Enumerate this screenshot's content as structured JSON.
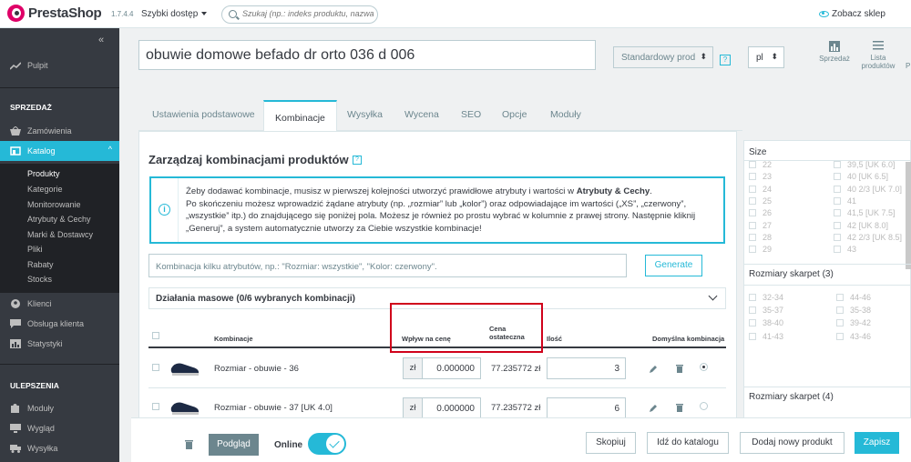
{
  "header": {
    "brand": "PrestaShop",
    "version": "1.7.4.4",
    "quick_access": "Szybki dostęp",
    "search_placeholder": "Szukaj (np.: indeks produktu, nazwa klie",
    "view_shop": "Zobacz sklep"
  },
  "sidebar": {
    "dashboard": "Pulpit",
    "section_sales": "SPRZEDAŻ",
    "orders": "Zamówienia",
    "catalog": "Katalog",
    "catalog_items": [
      "Produkty",
      "Kategorie",
      "Monitorowanie",
      "Atrybuty & Cechy",
      "Marki & Dostawcy",
      "Pliki",
      "Rabaty",
      "Stocks"
    ],
    "customers": "Klienci",
    "service": "Obsługa klienta",
    "stats": "Statystyki",
    "section_improve": "ULEPSZENIA",
    "modules": "Moduły",
    "design": "Wygląd",
    "shipping": "Wysyłka"
  },
  "product": {
    "name": "obuwie domowe befado dr orto 036 d 006",
    "type": "Standardowy prod",
    "lang": "pl"
  },
  "toolbar": {
    "sales": "Sprzedaż",
    "product_list_1": "Lista",
    "product_list_2": "produktów",
    "extra": "P"
  },
  "tabs": [
    "Ustawienia podstawowe",
    "Kombinacje",
    "Wysyłka",
    "Wycena",
    "SEO",
    "Opcje",
    "Moduły"
  ],
  "combinations": {
    "title": "Zarządzaj kombinacjami produktów",
    "info_line1_pre": "Żeby dodawać kombinacje, musisz w pierwszej kolejności utworzyć prawidłowe atrybuty i wartości w ",
    "info_line1_bold": "Atrybuty & Cechy",
    "info_line1_post": ".",
    "info_line2": "Po skończeniu możesz wprowadzić żądane atrybuty (np. „rozmiar” lub „kolor”) oraz odpowiadające im wartości („XS”, „czerwony”,",
    "info_line3": "„wszystkie” itp.) do znajdującego się poniżej pola. Możesz je również po prostu wybrać w kolumnie z prawej strony. Następnie kliknij",
    "info_line4": "„Generuj”, a system automatycznie utworzy za Ciebie wszystkie kombinacje!",
    "input_placeholder": "Kombinacja kilku atrybutów, np.: \"Rozmiar: wszystkie\", \"Kolor: czerwony\".",
    "generate": "Generate",
    "bulk": "Działania masowe (0/6 wybranych kombinacji)",
    "columns": {
      "combination": "Kombinacje",
      "impact_price": "Wpływ na cenę",
      "final_price_1": "Cena",
      "final_price_2": "ostateczna",
      "quantity": "Ilość",
      "default": "Domyślna kombinacja"
    },
    "rows": [
      {
        "name": "Rozmiar - obuwie - 36",
        "currency": "zł",
        "impact": "0.000000",
        "final": "77.235772 zł",
        "qty": "3",
        "default": true
      },
      {
        "name": "Rozmiar - obuwie - 37 [UK 4.0]",
        "currency": "zł",
        "impact": "0.000000",
        "final": "77.235772 zł",
        "qty": "6",
        "default": false
      }
    ]
  },
  "filters": {
    "size_title": "Size",
    "size_left": [
      "22",
      "23",
      "24",
      "25",
      "26",
      "27",
      "28",
      "29"
    ],
    "size_right": [
      "39,5 [UK 6.0]",
      "40 [UK 6.5]",
      "40 2/3 [UK 7.0]",
      "41",
      "41,5 [UK 7.5]",
      "42 [UK 8.0]",
      "42 2/3 [UK 8.5]",
      "43"
    ],
    "socks3_title": "Rozmiary skarpet (3)",
    "socks3_left": [
      "32-34",
      "35-37",
      "38-40",
      "41-43"
    ],
    "socks3_right": [
      "44-46",
      "35-38",
      "39-42",
      "43-46"
    ],
    "socks4_title": "Rozmiary skarpet (4)"
  },
  "footer": {
    "preview": "Podgląd",
    "online": "Online",
    "duplicate": "Skopiuj",
    "go_catalog": "Idź do katalogu",
    "add_new": "Dodaj nowy produkt",
    "save": "Zapisz"
  },
  "colors": {
    "accent": "#25b9d7",
    "sidebar": "#363a41",
    "highlight": "#d0021b",
    "brand": "#df0067"
  }
}
